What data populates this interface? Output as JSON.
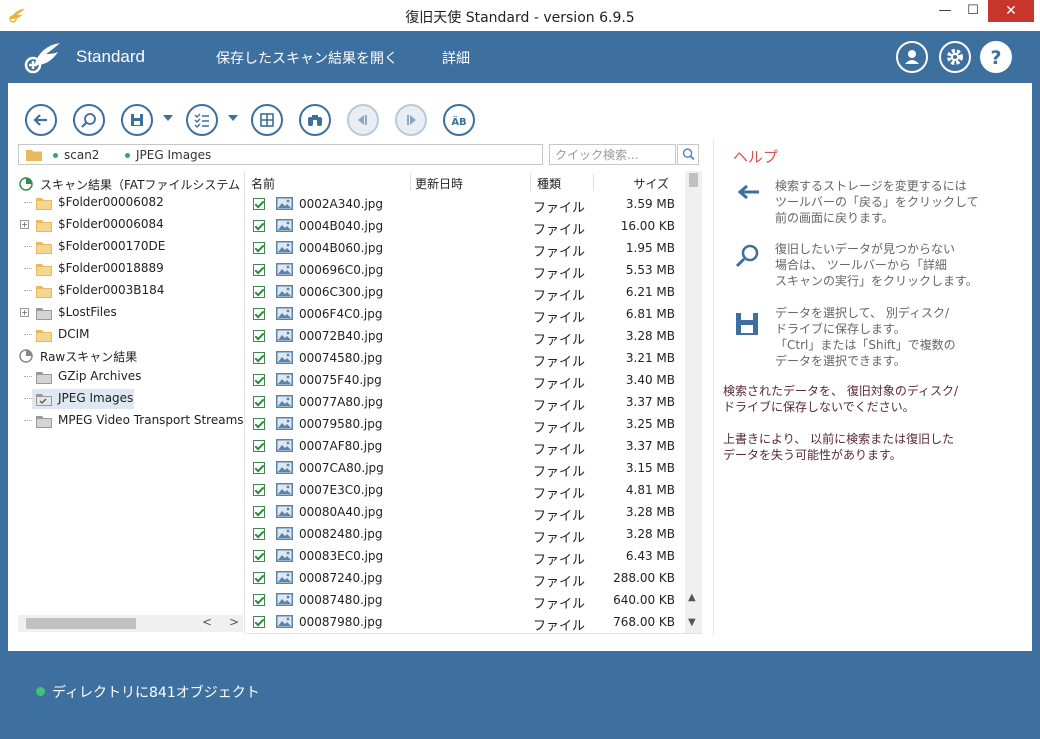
{
  "window": {
    "title": "復旧天使 Standard - version 6.9.5",
    "min": "—",
    "max": "☐",
    "close": "✕"
  },
  "header": {
    "brand": "Standard",
    "nav": [
      "保存したスキャン結果を開く",
      "詳細"
    ]
  },
  "path": {
    "segments": [
      "scan2",
      "JPEG Images"
    ]
  },
  "search": {
    "placeholder": "クイック検索..."
  },
  "tree": {
    "items": [
      {
        "label": "スキャン結果（FATファイルシステム",
        "type": "root"
      },
      {
        "label": "$Folder00006082",
        "type": "folder",
        "expander": ""
      },
      {
        "label": "$Folder00006084",
        "type": "folder",
        "expander": "+"
      },
      {
        "label": "$Folder000170DE",
        "type": "folder",
        "expander": ""
      },
      {
        "label": "$Folder00018889",
        "type": "folder",
        "expander": ""
      },
      {
        "label": "$Folder0003B184",
        "type": "folder",
        "expander": ""
      },
      {
        "label": "$LostFiles",
        "type": "gray",
        "expander": "+"
      },
      {
        "label": "DCIM",
        "type": "folder",
        "expander": ""
      },
      {
        "label": "Rawスキャン結果",
        "type": "root2"
      },
      {
        "label": "GZip Archives",
        "type": "gray",
        "expander": ""
      },
      {
        "label": "JPEG Images",
        "type": "gray-check",
        "expander": "",
        "selected": true
      },
      {
        "label": "MPEG Video Transport Streams",
        "type": "gray",
        "expander": ""
      }
    ],
    "scroll_left": "<",
    "scroll_right": ">"
  },
  "columns": {
    "name": "名前",
    "modified": "更新日時",
    "type": "種類",
    "size": "サイズ"
  },
  "files": [
    {
      "name": "0002A340.jpg",
      "type": "ファイル",
      "size": "3.59 MB"
    },
    {
      "name": "0004B040.jpg",
      "type": "ファイル",
      "size": "16.00 KB"
    },
    {
      "name": "0004B060.jpg",
      "type": "ファイル",
      "size": "1.95 MB"
    },
    {
      "name": "000696C0.jpg",
      "type": "ファイル",
      "size": "5.53 MB"
    },
    {
      "name": "0006C300.jpg",
      "type": "ファイル",
      "size": "6.21 MB"
    },
    {
      "name": "0006F4C0.jpg",
      "type": "ファイル",
      "size": "6.81 MB"
    },
    {
      "name": "00072B40.jpg",
      "type": "ファイル",
      "size": "3.28 MB"
    },
    {
      "name": "00074580.jpg",
      "type": "ファイル",
      "size": "3.21 MB"
    },
    {
      "name": "00075F40.jpg",
      "type": "ファイル",
      "size": "3.40 MB"
    },
    {
      "name": "00077A80.jpg",
      "type": "ファイル",
      "size": "3.37 MB"
    },
    {
      "name": "00079580.jpg",
      "type": "ファイル",
      "size": "3.25 MB"
    },
    {
      "name": "0007AF80.jpg",
      "type": "ファイル",
      "size": "3.37 MB"
    },
    {
      "name": "0007CA80.jpg",
      "type": "ファイル",
      "size": "3.15 MB"
    },
    {
      "name": "0007E3C0.jpg",
      "type": "ファイル",
      "size": "4.81 MB"
    },
    {
      "name": "00080A40.jpg",
      "type": "ファイル",
      "size": "3.28 MB"
    },
    {
      "name": "00082480.jpg",
      "type": "ファイル",
      "size": "3.28 MB"
    },
    {
      "name": "00083EC0.jpg",
      "type": "ファイル",
      "size": "6.43 MB"
    },
    {
      "name": "00087240.jpg",
      "type": "ファイル",
      "size": "288.00 KB"
    },
    {
      "name": "00087480.jpg",
      "type": "ファイル",
      "size": "640.00 KB"
    },
    {
      "name": "00087980.jpg",
      "type": "ファイル",
      "size": "768.00 KB"
    }
  ],
  "help": {
    "title": "ヘルプ",
    "items": [
      {
        "icon": "back-arrow-icon",
        "text": "検索するストレージを変更するには\nツールバーの「戻る」をクリックして\n前の画面に戻ります。"
      },
      {
        "icon": "magnifier-icon",
        "text": "復旧したいデータが見つからない\n場合は、 ツールバーから「詳細\nスキャンの実行」をクリックします。"
      },
      {
        "icon": "save-disk-icon",
        "text": "データを選択して、 別ディスク/\nドライブに保存します。\n「Ctrl」または「Shift」で複数の\nデータを選択できます。"
      }
    ],
    "warnings": [
      "検索されたデータを、 復旧対象のディスク/\nドライブに保存しないでください。",
      "上書きにより、 以前に検索または復旧した\nデータを失う可能性があります。"
    ]
  },
  "status": {
    "text": "ディレクトリに841オブジェクト"
  },
  "colors": {
    "accent": "#3d6f9f",
    "status_dot": "#3ec47a",
    "help_title": "#d9534f",
    "close": "#c7352b"
  }
}
